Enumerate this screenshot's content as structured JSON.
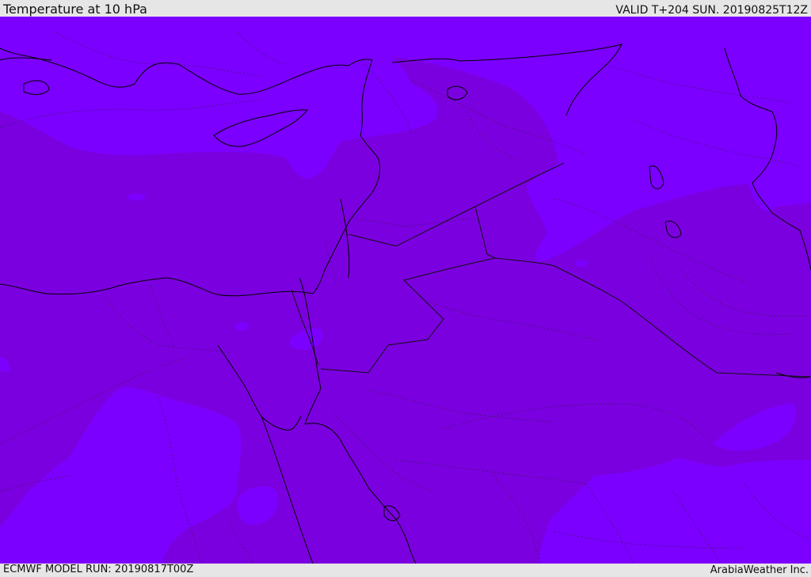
{
  "header": {
    "title": "Temperature at 10 hPa",
    "valid_time": "VALID T+204 SUN. 20190825T12Z"
  },
  "footer": {
    "model_run": "ECMWF MODEL RUN: 20190817T00Z",
    "credit": "ArabiaWeather Inc."
  },
  "map": {
    "field": "Temperature",
    "level": "10 hPa",
    "colors": {
      "warmer_band": "#7c00ff",
      "cooler_band": "#7b00df",
      "coastline": "#000000",
      "border": "#222222"
    }
  }
}
